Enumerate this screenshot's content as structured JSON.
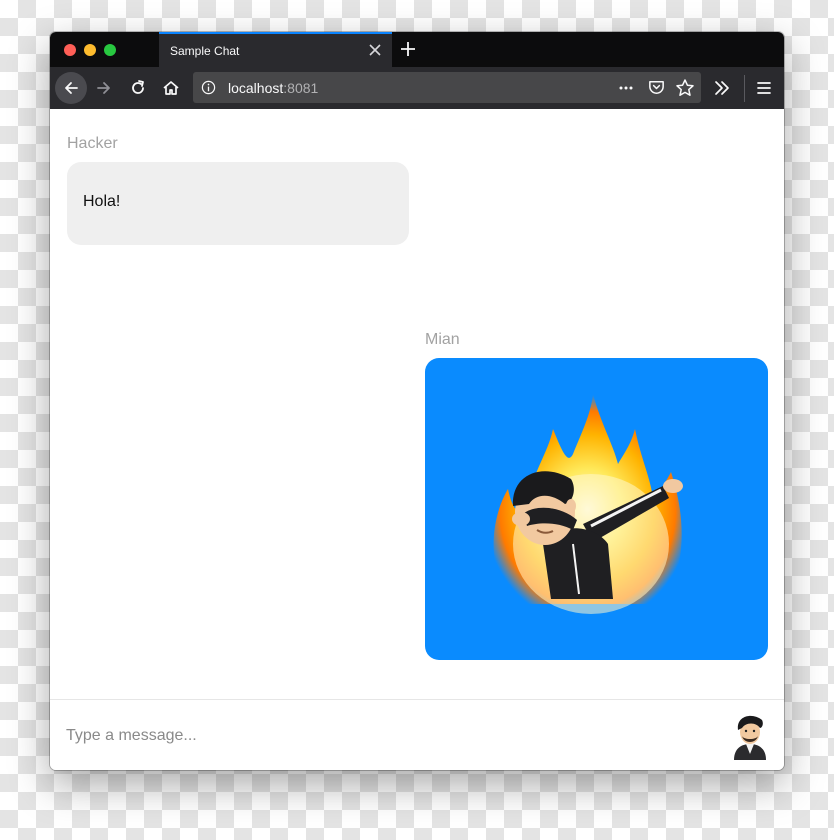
{
  "browser": {
    "tab_title": "Sample Chat",
    "url_host": "localhost",
    "url_port": ":8081",
    "icons": {
      "back": "back-arrow-icon",
      "forward": "forward-arrow-icon",
      "reload": "reload-icon",
      "home": "home-icon",
      "info": "info-icon",
      "more": "more-dots-icon",
      "pocket": "pocket-icon",
      "bookmark": "star-icon",
      "overflow": "chevron-double-right-icon",
      "menu": "hamburger-menu-icon",
      "tab_close": "close-icon",
      "new_tab": "plus-icon"
    },
    "colors": {
      "chrome": "#0c0c0d",
      "toolbar": "#2a2a2e",
      "accent": "#0a84ff"
    }
  },
  "chat": {
    "messages": [
      {
        "sender": "Hacker",
        "type": "text",
        "text": "Hola!",
        "bubble_color": "#efefef"
      },
      {
        "sender": "Mian",
        "type": "sticker",
        "sticker": "dabbing-avatar-fire-sticker",
        "bubble_color": "#0a8bfe"
      }
    ],
    "composer": {
      "placeholder": "Type a message...",
      "avatar_icon": "user-avatar-icon"
    }
  }
}
